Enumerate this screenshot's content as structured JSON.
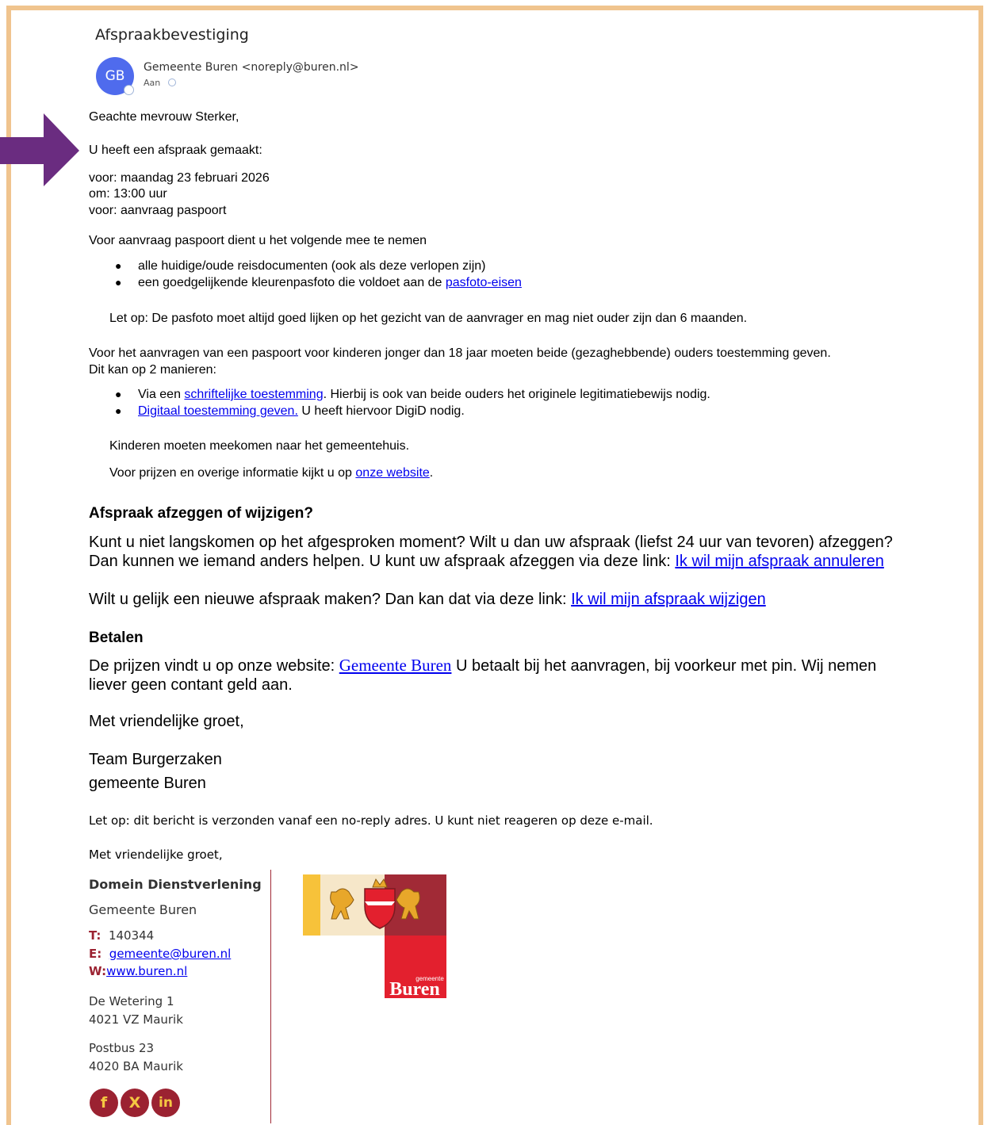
{
  "email": {
    "subject": "Afspraakbevestiging",
    "avatar_initials": "GB",
    "sender": "Gemeente Buren <noreply@buren.nl>",
    "to_label": "Aan"
  },
  "body": {
    "greeting": "Geachte mevrouw Sterker,",
    "intro": "U heeft een afspraak gemaakt:",
    "date_line": "voor: maandag 23 februari 2026",
    "time_line": "om: 13:00 uur",
    "purpose_line": "voor: aanvraag paspoort",
    "bring_intro": "Voor aanvraag paspoort dient u het volgende mee te nemen",
    "bullet1": "alle huidige/oude reisdocumenten (ook als deze verlopen zijn)",
    "bullet2_text": "een goedgelijkende kleurenpasfoto die voldoet aan de ",
    "bullet2_link": "pasfoto-eisen",
    "photo_note": "Let op: De pasfoto moet altijd goed lijken op het gezicht van de aanvrager en mag niet ouder zijn dan 6 maanden.",
    "children_line1": "Voor het aanvragen van een paspoort voor kinderen jonger dan 18 jaar moeten beide (gezaghebbende) ouders toestemming geven.",
    "children_line2": "Dit kan op 2 manieren:",
    "consent1_pre": "Via een ",
    "consent1_link": "schriftelijke toestemming",
    "consent1_post": ". Hierbij is ook van beide ouders het originele legitimatiebewijs nodig.",
    "consent2_link": "Digitaal toestemming geven.",
    "consent2_post": " U heeft hiervoor DigiD nodig.",
    "kids_come": "Kinderen moeten meekomen naar het gemeentehuis.",
    "prices_pre": "Voor prijzen en overige informatie kijkt u op ",
    "prices_link": "onze website",
    "prices_post": ".",
    "cancel_heading": "Afspraak afzeggen of wijzigen?",
    "cancel_line1": "Kunt u niet langskomen op het afgesproken moment? Wilt u dan uw afspraak (liefst 24 uur van tevoren) afzeggen?",
    "cancel_line2_pre": "Dan kunnen we iemand anders helpen. U kunt uw afspraak afzeggen via deze link: ",
    "cancel_link": "Ik wil mijn afspraak annuleren",
    "change_pre": "Wilt u gelijk een nieuwe afspraak maken? Dan kan dat via deze link: ",
    "change_link": "Ik wil mijn afspraak wijzigen",
    "pay_heading": "Betalen",
    "pay_line1_pre": "De prijzen vindt u op onze website: ",
    "pay_link": "Gemeente Buren",
    "pay_line1_post": " U betaalt bij het aanvragen, bij voorkeur met pin. Wij nemen",
    "pay_line2": "liever geen contant geld aan.",
    "closing": "Met vriendelijke groet,",
    "team": "Team Burgerzaken",
    "municipality": "gemeente Buren",
    "noreply_note": "Let op: dit bericht is verzonden vanaf een no-reply adres. U kunt niet reageren op deze e-mail.",
    "closing2": "Met vriendelijke groet,"
  },
  "signature": {
    "department": "Domein Dienstverlening",
    "org": "Gemeente Buren",
    "phone_label": "T:",
    "phone": "140344",
    "email_label": "E:",
    "email": "gemeente@buren.nl",
    "web_label": "W:",
    "web": "www.buren.nl",
    "address1": "De Wetering 1",
    "address2": "4021 VZ Maurik",
    "postbus1": "Postbus 23",
    "postbus2": "4020 BA Maurik",
    "logo_small": "gemeente",
    "logo_big": "Buren",
    "social_f": "f",
    "social_x": "X",
    "social_in": "in"
  },
  "colors": {
    "frame": "#f0c48e",
    "arrow": "#6a2c80",
    "link": "#0000ee",
    "accent_red": "#9b2231"
  }
}
